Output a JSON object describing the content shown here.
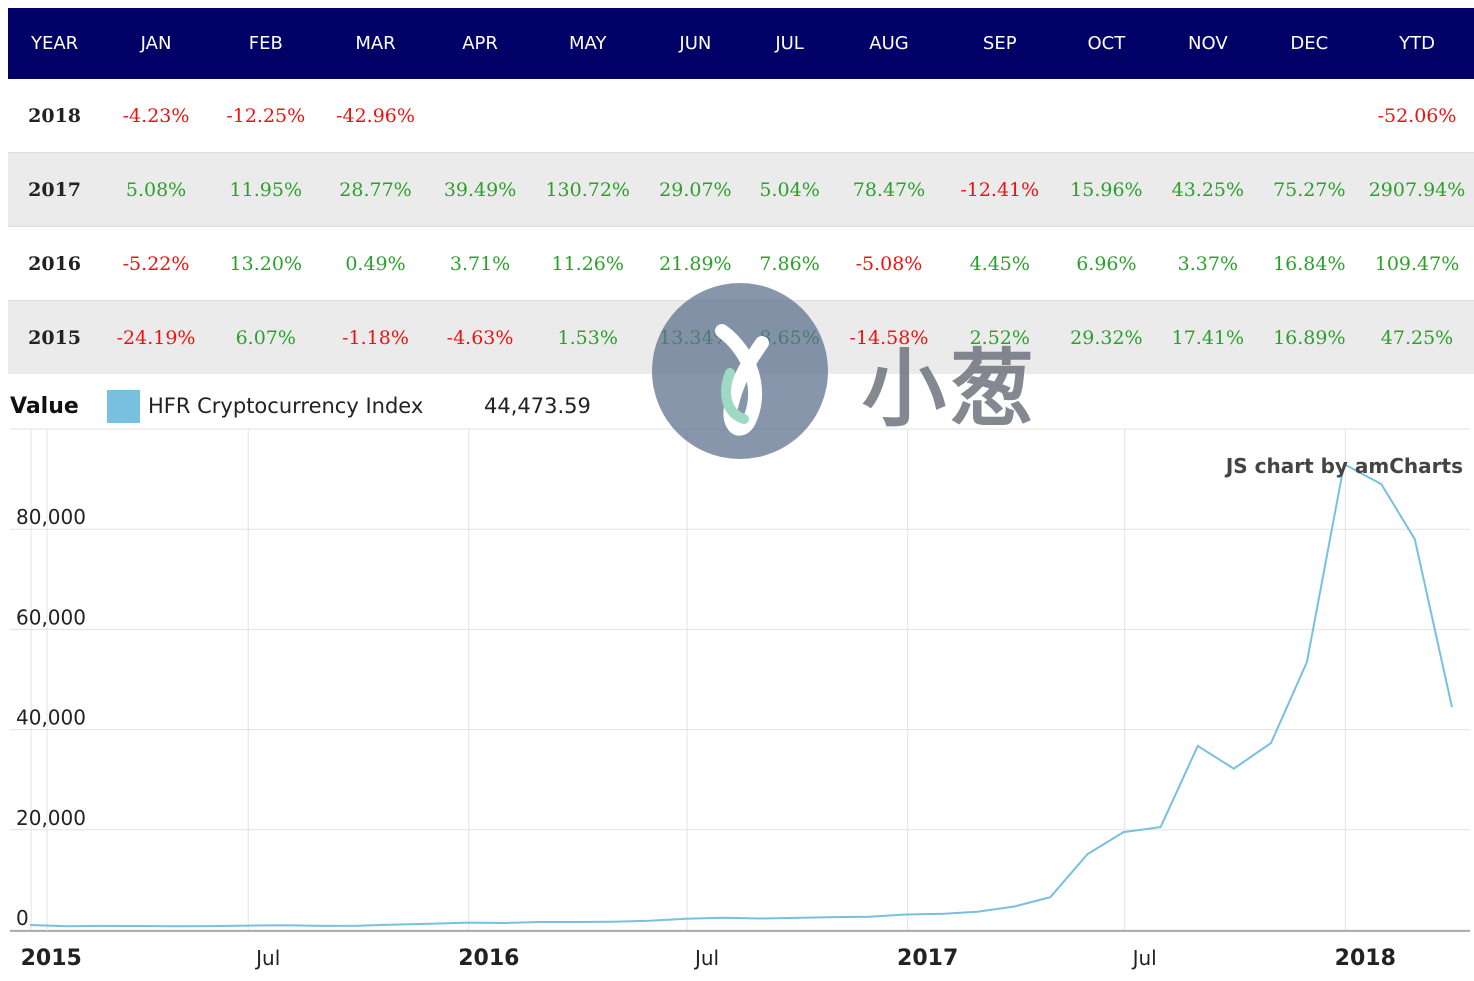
{
  "table": {
    "headers": [
      "YEAR",
      "JAN",
      "FEB",
      "MAR",
      "APR",
      "MAY",
      "JUN",
      "JUL",
      "AUG",
      "SEP",
      "OCT",
      "NOV",
      "DEC",
      "YTD"
    ],
    "rows": [
      {
        "year": "2018",
        "cells": [
          "-4.23%",
          "-12.25%",
          "-42.96%",
          "",
          "",
          "",
          "",
          "",
          "",
          "",
          "",
          "",
          "-52.06%"
        ]
      },
      {
        "year": "2017",
        "cells": [
          "5.08%",
          "11.95%",
          "28.77%",
          "39.49%",
          "130.72%",
          "29.07%",
          "5.04%",
          "78.47%",
          "-12.41%",
          "15.96%",
          "43.25%",
          "75.27%",
          "2907.94%"
        ]
      },
      {
        "year": "2016",
        "cells": [
          "-5.22%",
          "13.20%",
          "0.49%",
          "3.71%",
          "11.26%",
          "21.89%",
          "7.86%",
          "-5.08%",
          "4.45%",
          "6.96%",
          "3.37%",
          "16.84%",
          "109.47%"
        ]
      },
      {
        "year": "2015",
        "cells": [
          "-24.19%",
          "6.07%",
          "-1.18%",
          "-4.63%",
          "1.53%",
          "13.34%",
          "8.65%",
          "-14.58%",
          "2.52%",
          "29.32%",
          "17.41%",
          "16.89%",
          "47.25%"
        ]
      }
    ],
    "colors": {
      "header_bg": "#000066",
      "positive": "#2ca02c",
      "negative": "#ee1111",
      "stripe": "#ebebeb"
    }
  },
  "legend": {
    "value_label": "Value",
    "series_name": "HFR Cryptocurrency Index",
    "current_value": "44,473.59",
    "swatch_color": "#78c0e0"
  },
  "credit": "JS chart by amCharts",
  "watermark_text": "小葱",
  "chart_data": {
    "type": "line",
    "series": [
      {
        "name": "HFR Cryptocurrency Index",
        "color": "#78c0e0",
        "x": [
          "2014-12-31",
          "2015-01-31",
          "2015-02-28",
          "2015-03-31",
          "2015-04-30",
          "2015-05-31",
          "2015-06-30",
          "2015-07-31",
          "2015-08-31",
          "2015-09-30",
          "2015-10-31",
          "2015-11-30",
          "2015-12-31",
          "2016-01-31",
          "2016-02-29",
          "2016-03-31",
          "2016-04-30",
          "2016-05-31",
          "2016-06-30",
          "2016-07-31",
          "2016-08-31",
          "2016-09-30",
          "2016-10-31",
          "2016-11-30",
          "2016-12-31",
          "2017-01-31",
          "2017-02-28",
          "2017-03-31",
          "2017-04-30",
          "2017-05-31",
          "2017-06-30",
          "2017-07-31",
          "2017-08-31",
          "2017-09-30",
          "2017-10-31",
          "2017-11-30",
          "2017-12-31",
          "2018-01-31",
          "2018-02-28",
          "2018-03-31"
        ],
        "values": [
          1000,
          760,
          810,
          800,
          760,
          770,
          870,
          950,
          810,
          830,
          1070,
          1260,
          1480,
          1400,
          1590,
          1600,
          1660,
          1850,
          2250,
          2430,
          2300,
          2410,
          2580,
          2660,
          3100,
          3260,
          3650,
          4700,
          6550,
          15150,
          19550,
          20540,
          36750,
          32190,
          37330,
          53470,
          93000,
          89000,
          78000,
          44473.59
        ]
      }
    ],
    "xlabel": "",
    "ylabel": "",
    "ylim": [
      0,
      100000
    ],
    "yticks": [
      0,
      20000,
      40000,
      60000,
      80000
    ],
    "ytick_labels": [
      "0",
      "20,000",
      "40,000",
      "60,000",
      "80,000"
    ],
    "xticks": [
      {
        "date": "2015-01-01",
        "label": "2015",
        "bold": true
      },
      {
        "date": "2015-07-01",
        "label": "Jul",
        "bold": false
      },
      {
        "date": "2016-01-01",
        "label": "2016",
        "bold": true
      },
      {
        "date": "2016-07-01",
        "label": "Jul",
        "bold": false
      },
      {
        "date": "2017-01-01",
        "label": "2017",
        "bold": true
      },
      {
        "date": "2017-07-01",
        "label": "Jul",
        "bold": false
      },
      {
        "date": "2018-01-01",
        "label": "2018",
        "bold": true
      }
    ],
    "grid": true
  }
}
